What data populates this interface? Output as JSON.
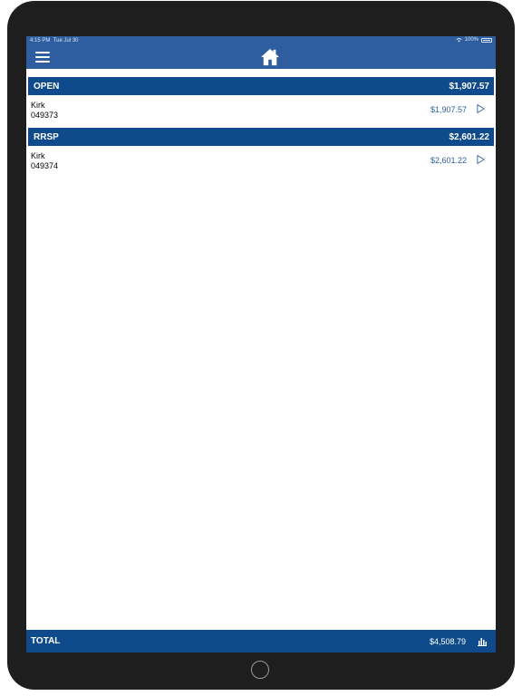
{
  "status_bar": {
    "time": "4:15 PM",
    "date": "Tue Jul 30",
    "battery": "100%"
  },
  "colors": {
    "header": "#2e5ea0",
    "section": "#0f4a8c",
    "amount": "#2e5ea0"
  },
  "accounts": [
    {
      "title": "OPEN",
      "total": "$1,907.57",
      "row": {
        "name": "Kirk",
        "number": "049373",
        "amount": "$1,907.57"
      }
    },
    {
      "title": "RRSP",
      "total": "$2,601.22",
      "row": {
        "name": "Kirk",
        "number": "049374",
        "amount": "$2,601.22"
      }
    }
  ],
  "footer": {
    "label": "TOTAL",
    "value": "$4,508.79"
  },
  "icons": [
    "menu-icon",
    "home-icon",
    "chevron-right-icon",
    "bar-chart-icon",
    "wifi-icon",
    "battery-icon"
  ]
}
